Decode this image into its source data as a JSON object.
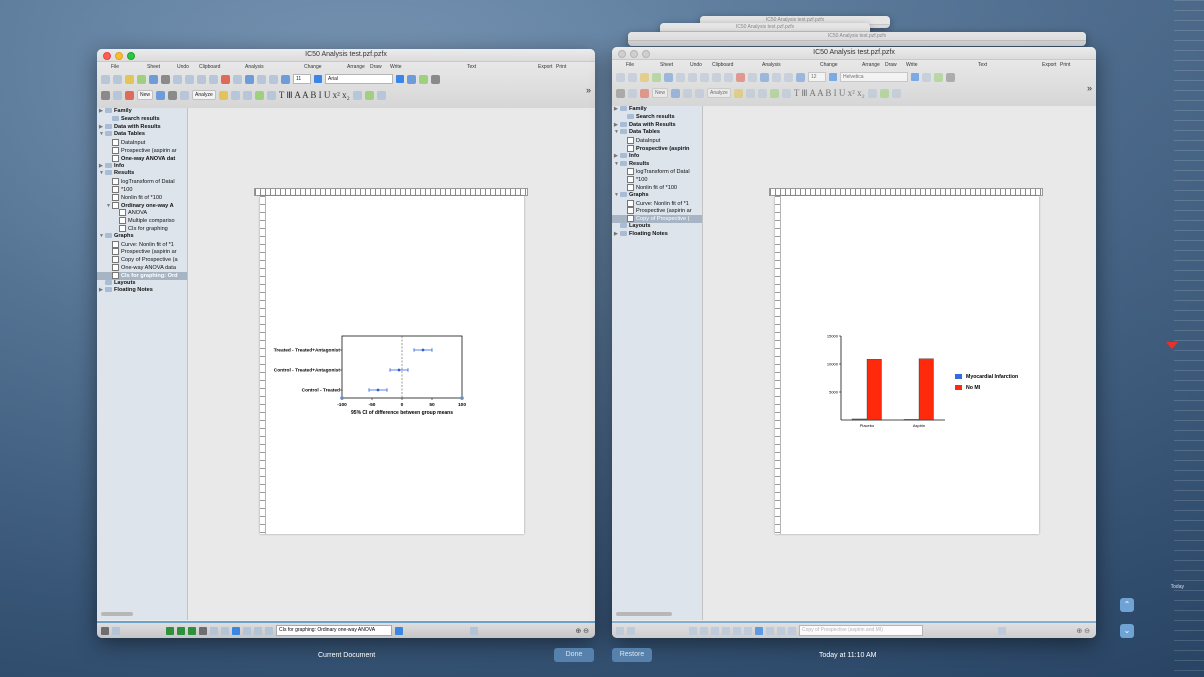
{
  "left_window": {
    "title": "IC50 Analysis test.pzf.pzfx",
    "toolbar_labels": [
      "File",
      "Sheet",
      "Undo",
      "Clipboard",
      "Analysis",
      "Change",
      "Arrange",
      "Draw",
      "Write",
      "Text",
      "Export",
      "Print"
    ],
    "font_size": "11",
    "font_name": "Arial",
    "new_label": "New",
    "analyze_label": "Analyze",
    "sidebar": [
      {
        "label": "Family",
        "bold": true,
        "indent": 0,
        "tri": "▶",
        "type": "folder"
      },
      {
        "label": "Search results",
        "bold": true,
        "indent": 1,
        "tri": "",
        "type": "folder"
      },
      {
        "label": "Data with Results",
        "bold": true,
        "indent": 0,
        "tri": "▶",
        "type": "folder"
      },
      {
        "label": "Data Tables",
        "bold": true,
        "indent": 0,
        "tri": "▼",
        "type": "folder"
      },
      {
        "label": "DataInput",
        "bold": false,
        "indent": 1,
        "tri": "",
        "type": "doc"
      },
      {
        "label": "Prospective (aspirin ar",
        "bold": false,
        "indent": 1,
        "tri": "",
        "type": "doc"
      },
      {
        "label": "One-way ANOVA dat",
        "bold": true,
        "indent": 1,
        "tri": "",
        "type": "doc"
      },
      {
        "label": "Info",
        "bold": true,
        "indent": 0,
        "tri": "▶",
        "type": "folder"
      },
      {
        "label": "Results",
        "bold": true,
        "indent": 0,
        "tri": "▼",
        "type": "folder"
      },
      {
        "label": "logTransform of Datal",
        "bold": false,
        "indent": 1,
        "tri": "",
        "type": "doc"
      },
      {
        "label": "*100",
        "bold": false,
        "indent": 1,
        "tri": "",
        "type": "doc"
      },
      {
        "label": "Nonlin fit of *100",
        "bold": false,
        "indent": 1,
        "tri": "",
        "type": "doc"
      },
      {
        "label": "Ordinary one-way A",
        "bold": true,
        "indent": 1,
        "tri": "▼",
        "type": "doc"
      },
      {
        "label": "ANOVA",
        "bold": false,
        "indent": 2,
        "tri": "",
        "type": "doc"
      },
      {
        "label": "Multiple compariso",
        "bold": false,
        "indent": 2,
        "tri": "",
        "type": "doc"
      },
      {
        "label": "CIs for graphing",
        "bold": false,
        "indent": 2,
        "tri": "",
        "type": "doc"
      },
      {
        "label": "Graphs",
        "bold": true,
        "indent": 0,
        "tri": "▼",
        "type": "folder"
      },
      {
        "label": "Curve: Nonlin fit of *1",
        "bold": false,
        "indent": 1,
        "tri": "",
        "type": "doc"
      },
      {
        "label": "Prospective (aspirin ar",
        "bold": false,
        "indent": 1,
        "tri": "",
        "type": "doc"
      },
      {
        "label": "Copy of Prospective (a",
        "bold": false,
        "indent": 1,
        "tri": "",
        "type": "doc"
      },
      {
        "label": "One-way ANOVA data",
        "bold": false,
        "indent": 1,
        "tri": "",
        "type": "doc"
      },
      {
        "label": "CIs for graphing: Ord",
        "bold": true,
        "indent": 1,
        "tri": "",
        "type": "doc",
        "selected": true
      },
      {
        "label": "Layouts",
        "bold": true,
        "indent": 0,
        "tri": "",
        "type": "folder"
      },
      {
        "label": "Floating Notes",
        "bold": true,
        "indent": 0,
        "tri": "▶",
        "type": "folder"
      }
    ],
    "status_field": "CIs for graphing: Ordinary one-way ANOVA"
  },
  "right_window": {
    "title": "IC50 Analysis test.pzf.pzfx",
    "ghost_titles": [
      "IC50 Analysis test.pzf.pzfx",
      "IC50 Analysis test.pzf.pzfx",
      "IC50 Analysis test.pzf.pzfx"
    ],
    "toolbar_labels": [
      "File",
      "Sheet",
      "Undo",
      "Clipboard",
      "Analysis",
      "Change",
      "Arrange",
      "Draw",
      "Write",
      "Text",
      "Export",
      "Print"
    ],
    "font_size": "12",
    "font_name": "Helvetica",
    "new_label": "New",
    "analyze_label": "Analyze",
    "sidebar": [
      {
        "label": "Family",
        "bold": true,
        "indent": 0,
        "tri": "▶",
        "type": "folder"
      },
      {
        "label": "Search results",
        "bold": true,
        "indent": 1,
        "tri": "",
        "type": "folder"
      },
      {
        "label": "Data with Results",
        "bold": true,
        "indent": 0,
        "tri": "▶",
        "type": "folder"
      },
      {
        "label": "Data Tables",
        "bold": true,
        "indent": 0,
        "tri": "▼",
        "type": "folder"
      },
      {
        "label": "DataInput",
        "bold": false,
        "indent": 1,
        "tri": "",
        "type": "doc"
      },
      {
        "label": "Prospective (aspirin",
        "bold": true,
        "indent": 1,
        "tri": "",
        "type": "doc"
      },
      {
        "label": "Info",
        "bold": true,
        "indent": 0,
        "tri": "▶",
        "type": "folder"
      },
      {
        "label": "Results",
        "bold": true,
        "indent": 0,
        "tri": "▼",
        "type": "folder"
      },
      {
        "label": "logTransform of Datal",
        "bold": false,
        "indent": 1,
        "tri": "",
        "type": "doc"
      },
      {
        "label": "*100",
        "bold": false,
        "indent": 1,
        "tri": "",
        "type": "doc"
      },
      {
        "label": "Nonlin fit of *100",
        "bold": false,
        "indent": 1,
        "tri": "",
        "type": "doc"
      },
      {
        "label": "Graphs",
        "bold": true,
        "indent": 0,
        "tri": "▼",
        "type": "folder"
      },
      {
        "label": "Curve: Nonlin fit of *1",
        "bold": false,
        "indent": 1,
        "tri": "",
        "type": "doc"
      },
      {
        "label": "Prospective (aspirin ar",
        "bold": false,
        "indent": 1,
        "tri": "",
        "type": "doc"
      },
      {
        "label": "Copy of Prospective (",
        "bold": false,
        "indent": 1,
        "tri": "",
        "type": "doc",
        "selected": true
      },
      {
        "label": "Layouts",
        "bold": true,
        "indent": 0,
        "tri": "",
        "type": "folder"
      },
      {
        "label": "Floating Notes",
        "bold": true,
        "indent": 0,
        "tri": "▶",
        "type": "folder"
      }
    ],
    "status_field": "Copy of Prospective (aspirin and MI)"
  },
  "bottom": {
    "current_document": "Current Document",
    "done": "Done",
    "restore": "Restore",
    "timestamp": "Today at 11:10 AM",
    "today": "Today"
  },
  "chart_data": [
    {
      "type": "scatter",
      "title": "",
      "xlabel": "95% CI of difference between group means",
      "ylabel": "",
      "xlim": [
        -100,
        100
      ],
      "xticks": [
        -100,
        -50,
        0,
        50,
        100
      ],
      "categories": [
        "Treated - Treated+Antagonist",
        "Control - Treated+Antagonist",
        "Control - Treated"
      ],
      "mean": [
        35,
        -5,
        -40
      ],
      "ci_low": [
        20,
        -20,
        -55
      ],
      "ci_high": [
        50,
        10,
        -25
      ],
      "color": "#2a5fd6"
    },
    {
      "type": "bar",
      "title": "",
      "xlabel": "",
      "ylabel": "",
      "categories": [
        "Placebo",
        "Aspirin"
      ],
      "ylim": [
        0,
        15000
      ],
      "yticks": [
        "5000",
        "10000",
        "15000"
      ],
      "series": [
        {
          "name": "Myocardial Infarction",
          "values": [
            189,
            104
          ],
          "color": "#2f6de0"
        },
        {
          "name": "No MI",
          "values": [
            10845,
            10933
          ],
          "color": "#ff2a0c"
        }
      ],
      "legend": "right"
    }
  ]
}
